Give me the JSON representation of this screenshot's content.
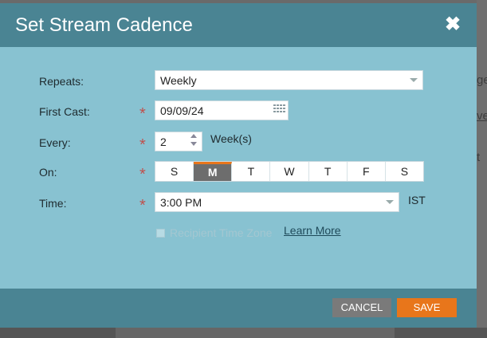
{
  "backdrop": {
    "right_text_1": "ge",
    "right_text_2": "ve",
    "right_text_3": "t"
  },
  "dialog": {
    "title": "Set Stream Cadence",
    "close_icon": "close-icon",
    "close_label": "✖"
  },
  "form": {
    "repeats": {
      "label": "Repeats:",
      "value": "Weekly"
    },
    "first_cast": {
      "label": "First Cast:",
      "value": "09/09/24",
      "icon": "calendar-icon"
    },
    "every": {
      "label": "Every:",
      "value": "2",
      "unit": "Week(s)"
    },
    "on": {
      "label": "On:",
      "days": [
        {
          "label": "S",
          "selected": false
        },
        {
          "label": "M",
          "selected": true
        },
        {
          "label": "T",
          "selected": false
        },
        {
          "label": "W",
          "selected": false
        },
        {
          "label": "T",
          "selected": false
        },
        {
          "label": "F",
          "selected": false
        },
        {
          "label": "S",
          "selected": false
        }
      ]
    },
    "time": {
      "label": "Time:",
      "value": "3:00 PM",
      "zone": "IST"
    },
    "recipient_time_zone": {
      "label": "Recipient Time Zone",
      "checked": false,
      "disabled": true
    },
    "learn_more": "Learn More",
    "required_mark": "*"
  },
  "footer": {
    "cancel_label": "CANCEL",
    "save_label": "SAVE"
  },
  "colors": {
    "header": "#4a8493",
    "body": "#88c2d1",
    "save": "#e8761b",
    "cancel": "#7a7a7a",
    "required": "#c0504d"
  }
}
